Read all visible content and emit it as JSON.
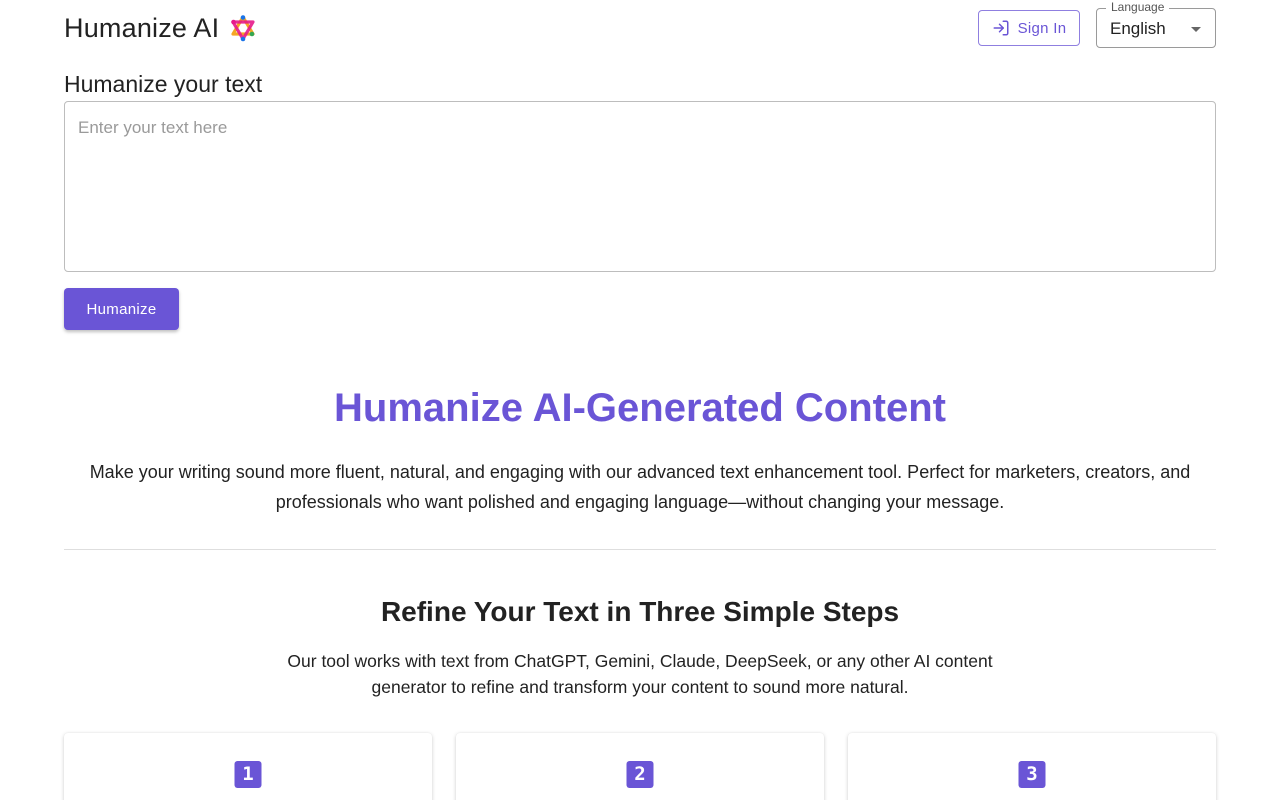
{
  "header": {
    "brand_title": "Humanize AI",
    "logo_icon": "colorful-star-logo",
    "sign_in_label": "Sign In",
    "language": {
      "legend": "Language",
      "selected": "English"
    }
  },
  "input_section": {
    "heading": "Humanize your text",
    "placeholder": "Enter your text here",
    "value": "",
    "button_label": "Humanize"
  },
  "hero": {
    "title": "Humanize AI-Generated Content",
    "description": "Make your writing sound more fluent, natural, and engaging with our advanced text enhancement tool. Perfect for marketers, creators, and professionals who want polished and engaging language—without changing your message."
  },
  "steps": {
    "title": "Refine Your Text in Three Simple Steps",
    "description": "Our tool works with text from ChatGPT, Gemini, Claude, DeepSeek, or any other AI content generator to refine and transform your content to sound more natural.",
    "cards": [
      {
        "number": "1"
      },
      {
        "number": "2"
      },
      {
        "number": "3"
      }
    ]
  },
  "colors": {
    "accent": "#6a55d6",
    "text": "#222222",
    "border": "#bdbdbd"
  }
}
